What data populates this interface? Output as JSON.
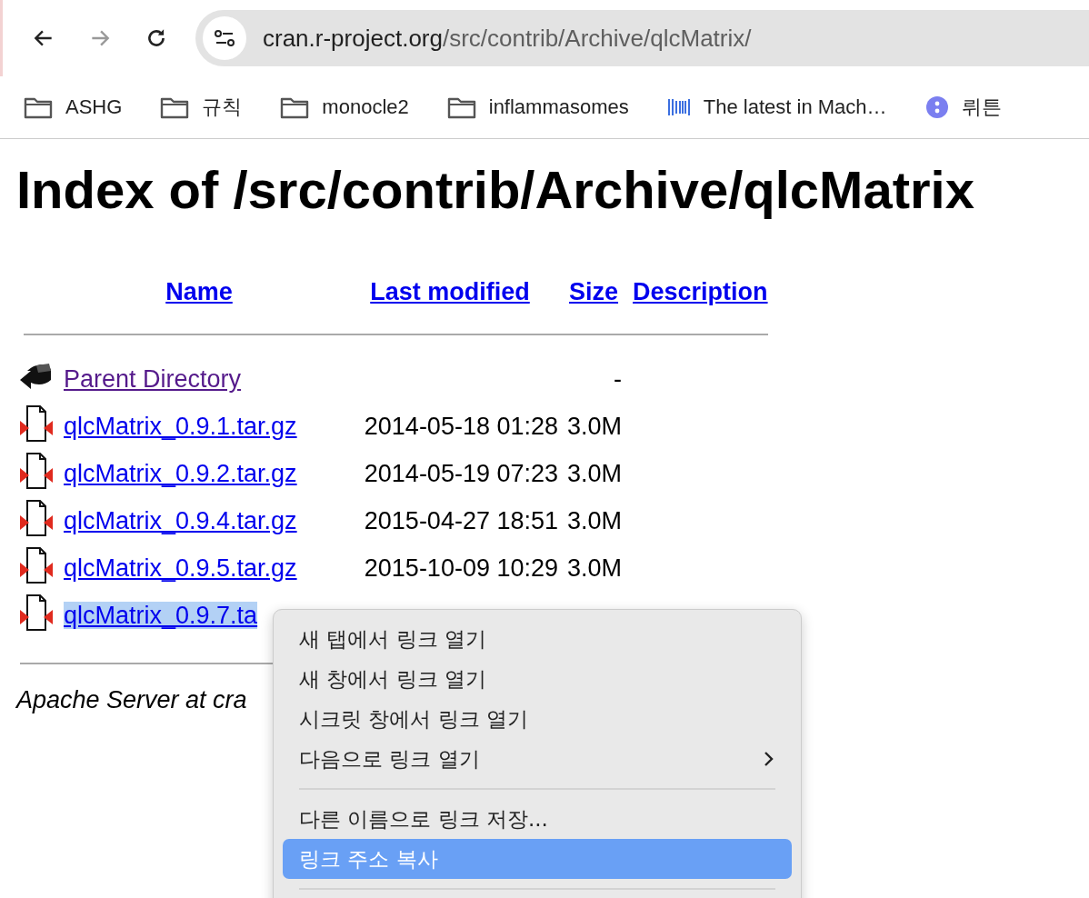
{
  "toolbar": {
    "nav": [
      {
        "kind": "back",
        "disabled": false
      },
      {
        "kind": "forward",
        "disabled": true
      },
      {
        "kind": "reload",
        "disabled": false
      }
    ],
    "address": {
      "host": "cran.r-project.org",
      "path": "/src/contrib/Archive/qlcMatrix/"
    }
  },
  "bookmarks": [
    {
      "kind": "folder",
      "label": "ASHG"
    },
    {
      "kind": "folder",
      "label": "규칙"
    },
    {
      "kind": "folder",
      "label": "monocle2"
    },
    {
      "kind": "folder",
      "label": "inflammasomes"
    },
    {
      "kind": "barcode",
      "label": "The latest in Mach…"
    },
    {
      "kind": "app",
      "label": "뤼튼"
    }
  ],
  "page": {
    "heading": "Index of /src/contrib/Archive/qlcMatrix",
    "columns": [
      "Name",
      "Last modified",
      "Size",
      "Description"
    ],
    "rows": [
      {
        "kind": "parent",
        "name": "Parent Directory",
        "visited": true,
        "selected": false,
        "modified": "",
        "size": "-"
      },
      {
        "kind": "file",
        "name": "qlcMatrix_0.9.1.tar.gz",
        "visited": false,
        "selected": false,
        "modified": "2014-05-18 01:28",
        "size": "3.0M"
      },
      {
        "kind": "file",
        "name": "qlcMatrix_0.9.2.tar.gz",
        "visited": false,
        "selected": false,
        "modified": "2014-05-19 07:23",
        "size": "3.0M"
      },
      {
        "kind": "file",
        "name": "qlcMatrix_0.9.4.tar.gz",
        "visited": false,
        "selected": false,
        "modified": "2015-04-27 18:51",
        "size": "3.0M"
      },
      {
        "kind": "file",
        "name": "qlcMatrix_0.9.5.tar.gz",
        "visited": false,
        "selected": false,
        "modified": "2015-10-09 10:29",
        "size": "3.0M"
      },
      {
        "kind": "file",
        "name": "qlcMatrix_0.9.7.ta",
        "visited": false,
        "selected": true,
        "modified": "",
        "size": ""
      }
    ],
    "footer": "Apache Server at cra"
  },
  "context_menu": {
    "groups": [
      [
        {
          "label": "새 탭에서 링크 열기",
          "submenu": false,
          "selected": false
        },
        {
          "label": "새 창에서 링크 열기",
          "submenu": false,
          "selected": false
        },
        {
          "label": "시크릿 창에서 링크 열기",
          "submenu": false,
          "selected": false
        },
        {
          "label": "다음으로 링크 열기",
          "submenu": true,
          "selected": false
        }
      ],
      [
        {
          "label": "다른 이름으로 링크 저장...",
          "submenu": false,
          "selected": false
        },
        {
          "label": "링크 주소 복사",
          "submenu": false,
          "selected": true
        }
      ]
    ]
  }
}
